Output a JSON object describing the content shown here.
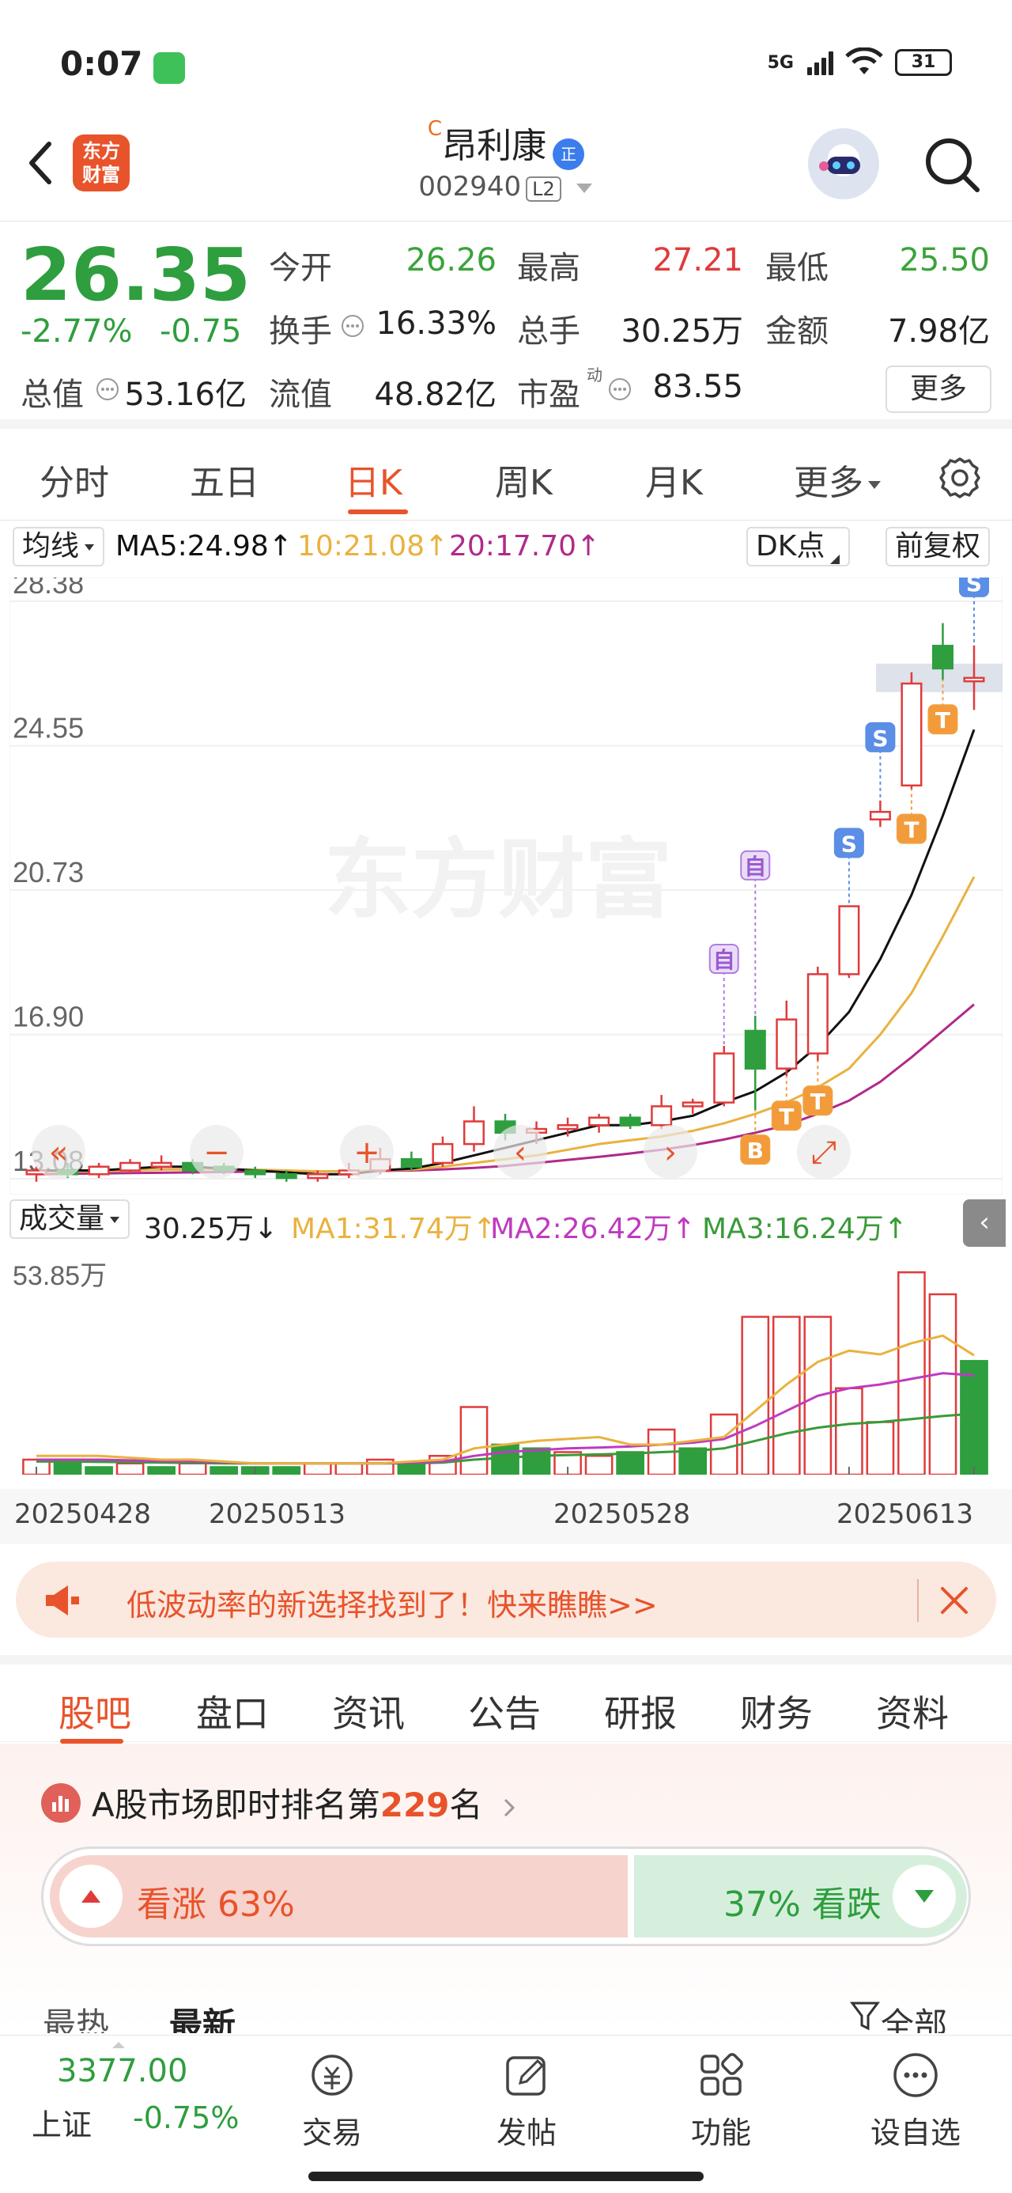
{
  "status_bar": {
    "time": "0:07",
    "network": "5G",
    "battery": "31"
  },
  "header": {
    "logo_line1": "东方",
    "logo_line2": "财富",
    "stock_prefix": "C",
    "stock_name": "昂利康",
    "badge": "正",
    "stock_code": "002940",
    "level_badge": "L2"
  },
  "quote": {
    "price": "26.35",
    "change_pct": "-2.77%",
    "change_val": "-0.75",
    "open_label": "今开",
    "open": "26.26",
    "high_label": "最高",
    "high": "27.21",
    "low_label": "最低",
    "low": "25.50",
    "turnover_label": "换手",
    "turnover": "16.33%",
    "volume_label": "总手",
    "volume": "30.25万",
    "amount_label": "金额",
    "amount": "7.98亿",
    "total_value_label": "总值",
    "total_value": "53.16亿",
    "float_value_label": "流值",
    "float_value": "48.82亿",
    "pe_label": "市盈",
    "pe_sup": "动",
    "pe": "83.55",
    "more": "更多"
  },
  "period_tabs": [
    "分时",
    "五日",
    "日K",
    "周K",
    "月K",
    "更多"
  ],
  "active_period": "日K",
  "ma_legend": {
    "selector": "均线",
    "ma5": "MA5:24.98",
    "ma10": "10:21.08",
    "ma20": "20:17.70",
    "dk": "DK点",
    "adjust": "前复权"
  },
  "volume_legend": {
    "selector": "成交量",
    "vol": "30.25万",
    "ma1": "MA1:31.74万",
    "ma2": "MA2:26.42万",
    "ma3": "MA3:16.24万"
  },
  "watermark": "东方财富",
  "colors": {
    "up": "#e03b3b",
    "down": "#2e9e3e",
    "accent": "#e8532b",
    "ma5": "#111111",
    "ma10": "#e9b23f",
    "ma20": "#b02a8a",
    "vma1": "#e9b23f",
    "vma2": "#c03ac0",
    "vma3": "#3a9a3a"
  },
  "chart_data": {
    "type": "candlestick",
    "y_ticks": [
      "28.38",
      "24.55",
      "20.73",
      "16.90",
      "13.08"
    ],
    "ylim": [
      13.08,
      28.38
    ],
    "volume_tick": "53.85万",
    "x_tick_labels": [
      "20250428",
      "20250513",
      "20250528",
      "20250613"
    ],
    "candles": [
      {
        "o": 13.2,
        "h": 13.4,
        "l": 13.0,
        "c": 13.3
      },
      {
        "o": 13.3,
        "h": 13.5,
        "l": 13.1,
        "c": 13.2
      },
      {
        "o": 13.2,
        "h": 13.5,
        "l": 13.1,
        "c": 13.4
      },
      {
        "o": 13.3,
        "h": 13.6,
        "l": 13.2,
        "c": 13.5
      },
      {
        "o": 13.4,
        "h": 13.7,
        "l": 13.3,
        "c": 13.5
      },
      {
        "o": 13.5,
        "h": 13.6,
        "l": 13.2,
        "c": 13.3
      },
      {
        "o": 13.4,
        "h": 13.5,
        "l": 13.2,
        "c": 13.3
      },
      {
        "o": 13.3,
        "h": 13.4,
        "l": 13.1,
        "c": 13.2
      },
      {
        "o": 13.2,
        "h": 13.3,
        "l": 13.0,
        "c": 13.1
      },
      {
        "o": 13.1,
        "h": 13.3,
        "l": 13.0,
        "c": 13.2
      },
      {
        "o": 13.2,
        "h": 13.5,
        "l": 13.1,
        "c": 13.3
      },
      {
        "o": 13.3,
        "h": 13.9,
        "l": 13.2,
        "c": 13.6
      },
      {
        "o": 13.6,
        "h": 13.8,
        "l": 13.3,
        "c": 13.4
      },
      {
        "o": 13.5,
        "h": 14.2,
        "l": 13.4,
        "c": 14.0
      },
      {
        "o": 14.0,
        "h": 15.0,
        "l": 13.8,
        "c": 14.6
      },
      {
        "o": 14.6,
        "h": 14.8,
        "l": 14.1,
        "c": 14.3
      },
      {
        "o": 14.3,
        "h": 14.6,
        "l": 14.0,
        "c": 14.4
      },
      {
        "o": 14.4,
        "h": 14.7,
        "l": 14.2,
        "c": 14.5
      },
      {
        "o": 14.5,
        "h": 14.8,
        "l": 14.3,
        "c": 14.7
      },
      {
        "o": 14.7,
        "h": 14.8,
        "l": 14.4,
        "c": 14.5
      },
      {
        "o": 14.5,
        "h": 15.3,
        "l": 14.4,
        "c": 15.0
      },
      {
        "o": 15.0,
        "h": 15.2,
        "l": 14.8,
        "c": 15.1
      },
      {
        "o": 15.1,
        "h": 16.6,
        "l": 15.0,
        "c": 16.4
      },
      {
        "o": 17.0,
        "h": 17.4,
        "l": 14.9,
        "c": 16.0
      },
      {
        "o": 16.0,
        "h": 17.8,
        "l": 15.8,
        "c": 17.3
      },
      {
        "o": 16.4,
        "h": 18.7,
        "l": 16.2,
        "c": 18.5
      },
      {
        "o": 18.5,
        "h": 20.3,
        "l": 18.4,
        "c": 20.3
      },
      {
        "o": 22.6,
        "h": 23.1,
        "l": 22.4,
        "c": 22.8
      },
      {
        "o": 23.5,
        "h": 26.5,
        "l": 23.4,
        "c": 26.2
      },
      {
        "o": 27.2,
        "h": 27.8,
        "l": 26.3,
        "c": 26.6
      },
      {
        "o": 26.26,
        "h": 27.21,
        "l": 25.5,
        "c": 26.35
      }
    ],
    "ma5": [
      13.3,
      13.3,
      13.3,
      13.35,
      13.4,
      13.4,
      13.35,
      13.3,
      13.25,
      13.2,
      13.2,
      13.3,
      13.35,
      13.5,
      13.7,
      13.9,
      14.1,
      14.3,
      14.5,
      14.5,
      14.6,
      14.75,
      15.1,
      15.4,
      15.9,
      16.6,
      17.5,
      18.9,
      20.6,
      22.7,
      24.98
    ],
    "ma10": [
      13.25,
      13.27,
      13.28,
      13.3,
      13.32,
      13.33,
      13.33,
      13.32,
      13.3,
      13.28,
      13.28,
      13.3,
      13.32,
      13.4,
      13.5,
      13.6,
      13.7,
      13.85,
      14.0,
      14.1,
      14.2,
      14.35,
      14.55,
      14.8,
      15.1,
      15.5,
      16.0,
      16.9,
      18.0,
      19.5,
      21.08
    ],
    "ma20": [
      13.2,
      13.21,
      13.22,
      13.23,
      13.24,
      13.25,
      13.26,
      13.27,
      13.27,
      13.28,
      13.28,
      13.29,
      13.3,
      13.33,
      13.37,
      13.42,
      13.5,
      13.58,
      13.66,
      13.75,
      13.85,
      13.97,
      14.12,
      14.3,
      14.5,
      14.8,
      15.15,
      15.65,
      16.3,
      17.0,
      17.7
    ],
    "volume_wan": [
      4,
      3,
      2,
      3,
      2,
      3,
      2,
      2,
      2,
      3,
      3,
      4,
      3,
      5,
      18,
      8,
      7,
      6,
      5,
      6,
      12,
      7,
      16,
      42,
      42,
      42,
      23,
      14,
      53.85,
      48,
      30.25
    ],
    "volume_dir": [
      "u",
      "d",
      "d",
      "u",
      "d",
      "u",
      "d",
      "d",
      "d",
      "u",
      "u",
      "u",
      "d",
      "u",
      "u",
      "d",
      "d",
      "u",
      "u",
      "d",
      "u",
      "d",
      "u",
      "u",
      "u",
      "u",
      "u",
      "u",
      "u",
      "u",
      "d"
    ],
    "vma1": [
      5,
      5,
      5,
      4.5,
      4,
      4,
      3.5,
      3,
      3,
      3,
      3,
      3,
      3.5,
      4,
      7,
      8,
      9,
      9.5,
      10,
      8,
      8,
      9,
      10,
      17,
      24,
      30,
      33,
      32,
      35,
      37,
      31.74
    ],
    "vma2": [
      4,
      4,
      4,
      3.8,
      3.6,
      3.5,
      3.3,
      3,
      3,
      3,
      3,
      3,
      3.2,
      3.5,
      5,
      6,
      6.5,
      7,
      7.2,
      7.5,
      8,
      8.5,
      9.5,
      13,
      17,
      21,
      23,
      24,
      25.5,
      27,
      26.42
    ],
    "vma3": [
      3.5,
      3.5,
      3.4,
      3.3,
      3.2,
      3.1,
      3,
      3,
      3,
      3,
      3,
      3,
      3,
      3.2,
      4,
      4.5,
      5,
      5.2,
      5.4,
      5.6,
      6,
      6.3,
      7,
      9,
      11,
      12.5,
      13.5,
      14,
      14.8,
      15.6,
      16.24
    ],
    "markers": [
      {
        "label": "自",
        "index": 22
      },
      {
        "label": "自",
        "index": 23
      },
      {
        "label": "B",
        "index": 23
      },
      {
        "label": "T",
        "index": 24
      },
      {
        "label": "T",
        "index": 25
      },
      {
        "label": "S",
        "index": 26
      },
      {
        "label": "S",
        "index": 27
      },
      {
        "label": "T",
        "index": 28
      },
      {
        "label": "T",
        "index": 29
      },
      {
        "label": "S",
        "index": 30
      }
    ]
  },
  "banner": {
    "text": "低波动率的新选择找到了！快来瞧瞧>>"
  },
  "content_tabs": [
    "股吧",
    "盘口",
    "资讯",
    "公告",
    "研报",
    "财务",
    "资料"
  ],
  "active_content_tab": "股吧",
  "rank": {
    "prefix": "A股市场即时排名第",
    "number": "229",
    "suffix": "名"
  },
  "sentiment": {
    "bull_label": "看涨 63%",
    "bear_label": "37% 看跌",
    "bull_pct": 63,
    "bear_pct": 37
  },
  "sort_tabs": [
    "最热",
    "最新",
    "全部"
  ],
  "bottom_nav": {
    "index_value": "3377.00",
    "index_name": "上证",
    "index_change": "-0.75%",
    "items": [
      "交易",
      "发帖",
      "功能",
      "设自选"
    ]
  }
}
